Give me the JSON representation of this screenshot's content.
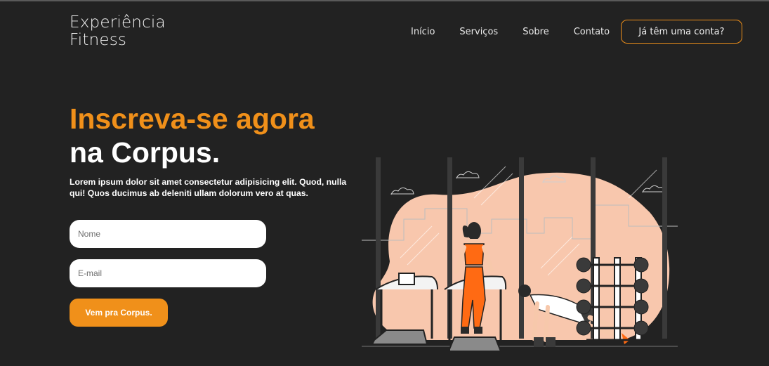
{
  "header": {
    "logo_line1": "Experiência",
    "logo_line2": "Fitness",
    "nav": [
      "Início",
      "Serviços",
      "Sobre",
      "Contato"
    ],
    "login_button": "Já têm uma conta?"
  },
  "hero": {
    "title_line1": "Inscreva-se agora",
    "title_line2": "na Corpus.",
    "description": "Lorem ipsum dolor sit amet consectetur adipisicing elit. Quod, nulla qui! Quos ducimus ab deleniti ullam dolorum vero at quas."
  },
  "form": {
    "name_placeholder": "Nome",
    "email_placeholder": "E-mail",
    "submit_label": "Vem pra Corpus."
  },
  "colors": {
    "accent": "#f0901a",
    "background": "#222222",
    "illustration_blob": "#f8c7ad"
  }
}
